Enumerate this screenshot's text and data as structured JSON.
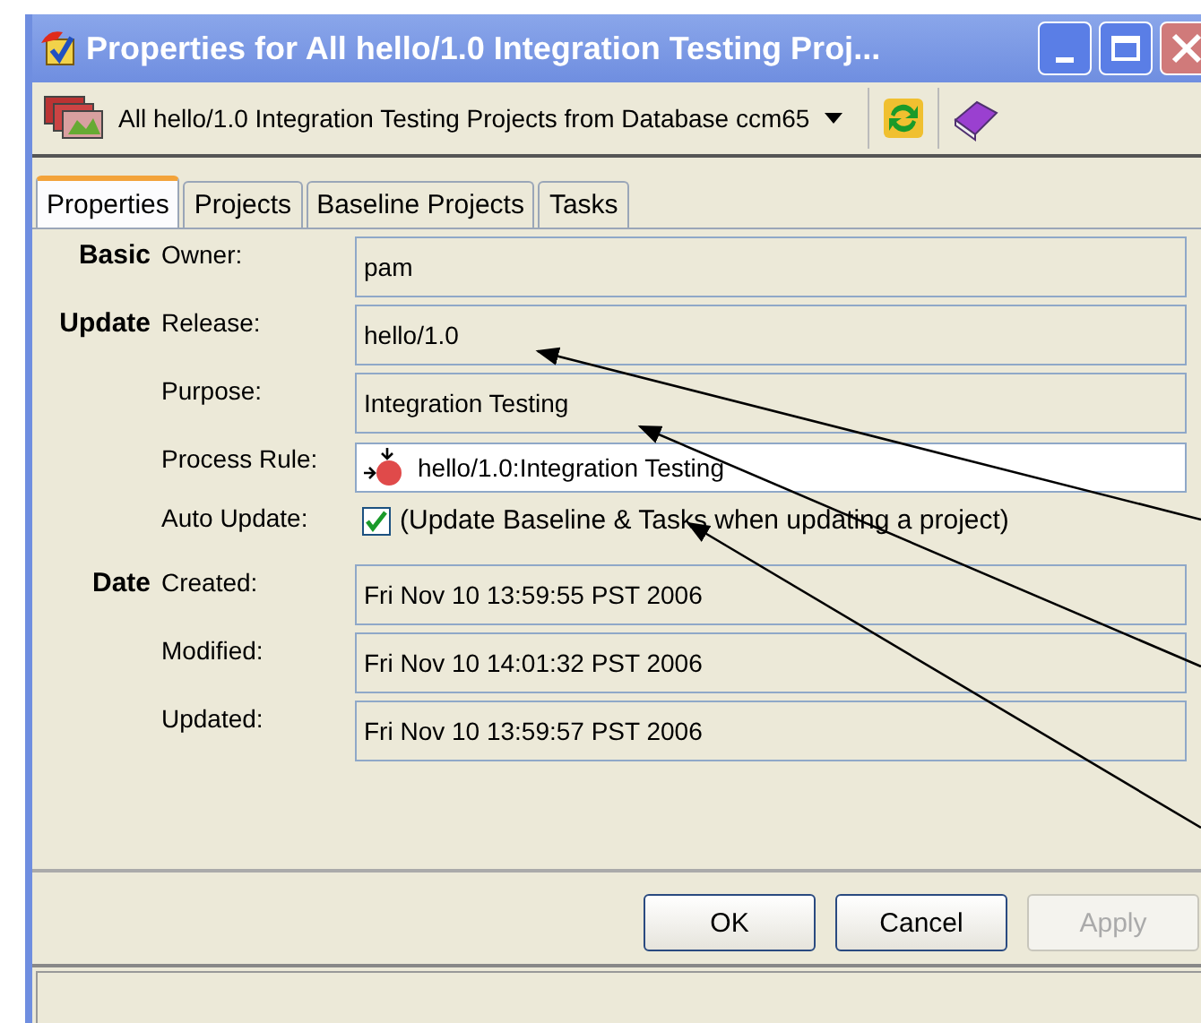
{
  "window": {
    "title": "Properties for All hello/1.0 Integration Testing Proj..."
  },
  "toolbar": {
    "scope": "All hello/1.0 Integration Testing Projects from Database ccm65"
  },
  "tabs": [
    {
      "label": "Properties",
      "selected": true
    },
    {
      "label": "Projects",
      "selected": false
    },
    {
      "label": "Baseline Projects",
      "selected": false
    },
    {
      "label": "Tasks",
      "selected": false
    }
  ],
  "sections": [
    {
      "group": "Basic",
      "fields": [
        {
          "kind": "readonly",
          "label": "Owner:",
          "value": "pam"
        }
      ]
    },
    {
      "group": "Update",
      "fields": [
        {
          "kind": "readonly",
          "label": "Release:",
          "value": "hello/1.0"
        },
        {
          "kind": "readonly",
          "label": "Purpose:",
          "value": "Integration Testing"
        },
        {
          "kind": "rule",
          "label": "Process Rule:",
          "value": "hello/1.0:Integration Testing"
        },
        {
          "kind": "checkbox",
          "label": "Auto Update:",
          "value": "(Update Baseline & Tasks when updating a project)",
          "checked": true
        }
      ]
    },
    {
      "group": "Date",
      "fields": [
        {
          "kind": "readonly",
          "label": "Created:",
          "value": "Fri Nov 10 13:59:55 PST 2006"
        },
        {
          "kind": "readonly",
          "label": "Modified:",
          "value": "Fri Nov 10 14:01:32 PST 2006"
        },
        {
          "kind": "readonly",
          "label": "Updated:",
          "value": "Fri Nov 10 13:59:57 PST 2006"
        }
      ]
    }
  ],
  "buttons": [
    {
      "label": "OK",
      "disabled": false
    },
    {
      "label": "Cancel",
      "disabled": false
    },
    {
      "label": "Apply",
      "disabled": true
    }
  ]
}
